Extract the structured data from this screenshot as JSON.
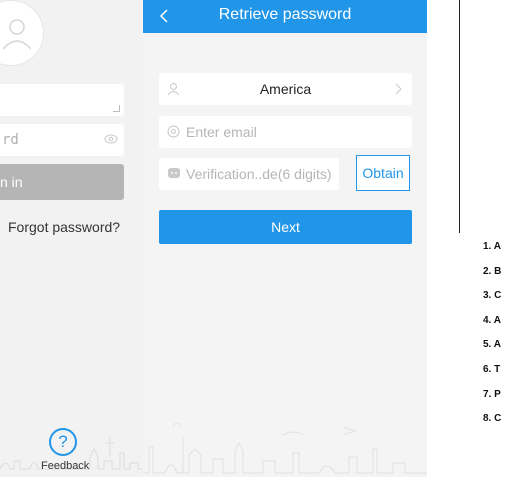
{
  "login_screen": {
    "password_placeholder": "rd",
    "signin_label": "n in",
    "forgot_password": "Forgot password?",
    "feedback_label": "Feedback"
  },
  "retrieve_screen": {
    "title": "Retrieve password",
    "country_value": "America",
    "email_placeholder": "Enter email",
    "code_placeholder": "Verification..de(6 digits)",
    "obtain_label": "Obtain",
    "next_label": "Next",
    "accent_color": "#2196e8"
  },
  "doc_steps": [
    "1. A",
    "2. B",
    "3. C",
    "4. A",
    "5. A",
    "6. T",
    "7. P",
    "8. C"
  ]
}
